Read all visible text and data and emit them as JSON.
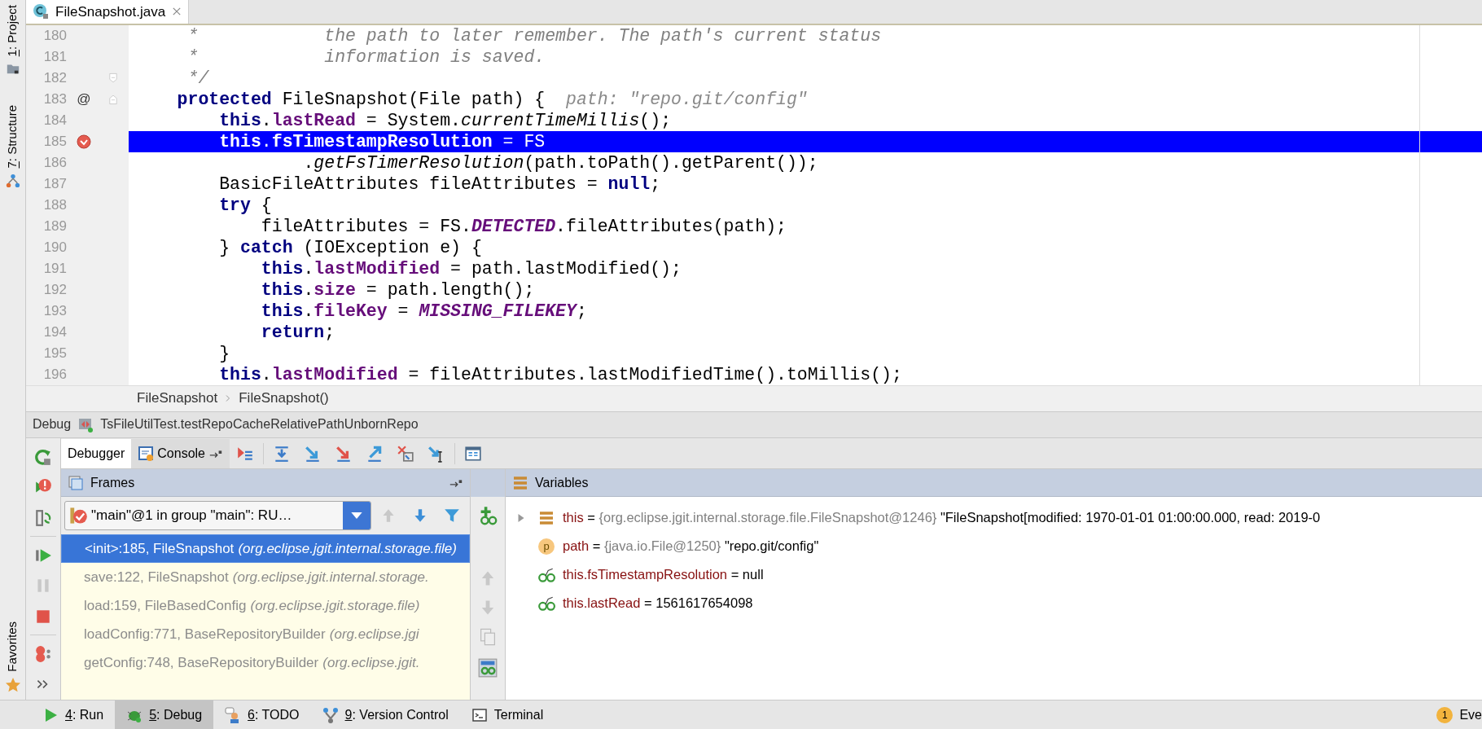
{
  "left_strip": {
    "top": [
      {
        "mnemonic": "1",
        "label": ": Project"
      },
      {
        "mnemonic": "7",
        "label": ": Structure"
      }
    ],
    "bottom": [
      {
        "label": "Favorites"
      }
    ]
  },
  "editor_tabs": [
    {
      "label": "FileSnapshot.java",
      "selected": true
    }
  ],
  "editor": {
    "lines": [
      {
        "number": "180",
        "tokens": [
          {
            "kind": "comment",
            "text": "     *            the path to later remember. The path's current status"
          }
        ]
      },
      {
        "number": "181",
        "tokens": [
          {
            "kind": "comment",
            "text": "     *            information is saved."
          }
        ]
      },
      {
        "number": "182",
        "fold_close": true,
        "tokens": [
          {
            "kind": "comment",
            "text": "     */"
          }
        ]
      },
      {
        "number": "183",
        "marker": "@",
        "fold_open": true,
        "tokens": [
          {
            "kind": "keyword",
            "text": "    protected"
          },
          {
            "kind": "plain",
            "text": " FileSnapshot(File path) {  "
          },
          {
            "kind": "hint",
            "text": "path: \"repo.git/config\""
          }
        ]
      },
      {
        "number": "184",
        "tokens": [
          {
            "kind": "keyword",
            "text": "        this"
          },
          {
            "kind": "plain",
            "text": "."
          },
          {
            "kind": "field",
            "text": "lastRead"
          },
          {
            "kind": "plain",
            "text": " = System."
          },
          {
            "kind": "static",
            "text": "currentTimeMillis"
          },
          {
            "kind": "plain",
            "text": "();"
          }
        ]
      },
      {
        "number": "185",
        "breakpoint": true,
        "current": true,
        "tokens": [
          {
            "kind": "keyword",
            "text": "        this"
          },
          {
            "kind": "plain",
            "text": "."
          },
          {
            "kind": "field",
            "text": "fsTimestampResolution"
          },
          {
            "kind": "plain",
            "text": " = FS"
          }
        ]
      },
      {
        "number": "186",
        "tokens": [
          {
            "kind": "plain",
            "text": "                ."
          },
          {
            "kind": "static",
            "text": "getFsTimerResolution"
          },
          {
            "kind": "plain",
            "text": "(path.toPath().getParent());"
          }
        ]
      },
      {
        "number": "187",
        "tokens": [
          {
            "kind": "plain",
            "text": "        BasicFileAttributes fileAttributes = "
          },
          {
            "kind": "keyword",
            "text": "null"
          },
          {
            "kind": "plain",
            "text": ";"
          }
        ]
      },
      {
        "number": "188",
        "tokens": [
          {
            "kind": "keyword",
            "text": "        try"
          },
          {
            "kind": "plain",
            "text": " {"
          }
        ]
      },
      {
        "number": "189",
        "tokens": [
          {
            "kind": "plain",
            "text": "            fileAttributes = FS."
          },
          {
            "kind": "constant",
            "text": "DETECTED"
          },
          {
            "kind": "plain",
            "text": ".fileAttributes(path);"
          }
        ]
      },
      {
        "number": "190",
        "tokens": [
          {
            "kind": "plain",
            "text": "        } "
          },
          {
            "kind": "keyword",
            "text": "catch"
          },
          {
            "kind": "plain",
            "text": " (IOException e) {"
          }
        ]
      },
      {
        "number": "191",
        "tokens": [
          {
            "kind": "keyword",
            "text": "            this"
          },
          {
            "kind": "plain",
            "text": "."
          },
          {
            "kind": "field",
            "text": "lastModified"
          },
          {
            "kind": "plain",
            "text": " = path.lastModified();"
          }
        ]
      },
      {
        "number": "192",
        "tokens": [
          {
            "kind": "keyword",
            "text": "            this"
          },
          {
            "kind": "plain",
            "text": "."
          },
          {
            "kind": "field",
            "text": "size"
          },
          {
            "kind": "plain",
            "text": " = path.length();"
          }
        ]
      },
      {
        "number": "193",
        "tokens": [
          {
            "kind": "keyword",
            "text": "            this"
          },
          {
            "kind": "plain",
            "text": "."
          },
          {
            "kind": "field",
            "text": "fileKey"
          },
          {
            "kind": "plain",
            "text": " = "
          },
          {
            "kind": "constant",
            "text": "MISSING_FILEKEY"
          },
          {
            "kind": "plain",
            "text": ";"
          }
        ]
      },
      {
        "number": "194",
        "tokens": [
          {
            "kind": "keyword",
            "text": "            return"
          },
          {
            "kind": "plain",
            "text": ";"
          }
        ]
      },
      {
        "number": "195",
        "tokens": [
          {
            "kind": "plain",
            "text": "        }"
          }
        ]
      },
      {
        "number": "196",
        "tokens": [
          {
            "kind": "keyword",
            "text": "        this"
          },
          {
            "kind": "plain",
            "text": "."
          },
          {
            "kind": "field",
            "text": "lastModified"
          },
          {
            "kind": "plain",
            "text": " = fileAttributes.lastModifiedTime().toMillis();"
          }
        ]
      }
    ]
  },
  "breadcrumbs": [
    "FileSnapshot",
    "FileSnapshot()"
  ],
  "debug": {
    "title": "Debug",
    "session": "TsFileUtilTest.testRepoCacheRelativePathUnbornRepo",
    "tabs": [
      {
        "label": "Debugger",
        "selected": true
      },
      {
        "label": "Console",
        "selected": false
      }
    ],
    "frames": {
      "title": "Frames",
      "thread": "\"main\"@1 in group \"main\": RU…",
      "items": [
        {
          "method": "<init>:185, FileSnapshot",
          "package": "(org.eclipse.jgit.internal.storage.file)",
          "selected": true
        },
        {
          "method": "save:122, FileSnapshot",
          "package": "(org.eclipse.jgit.internal.storage.",
          "selected": false
        },
        {
          "method": "load:159, FileBasedConfig",
          "package": "(org.eclipse.jgit.storage.file)",
          "selected": false
        },
        {
          "method": "loadConfig:771, BaseRepositoryBuilder",
          "package": "(org.eclipse.jgi",
          "selected": false
        },
        {
          "method": "getConfig:748, BaseRepositoryBuilder",
          "package": "(org.eclipse.jgit.",
          "selected": false
        }
      ]
    },
    "variables": {
      "title": "Variables",
      "items": [
        {
          "kind": "object",
          "expandable": true,
          "name": "this",
          "equals": "=",
          "type": "{org.eclipse.jgit.internal.storage.file.FileSnapshot@1246}",
          "value": "\"FileSnapshot[modified: 1970-01-01 01:00:00.000, read: 2019-0"
        },
        {
          "kind": "parameter",
          "badge": "p",
          "expandable": false,
          "name": "path",
          "equals": "=",
          "type": "{java.io.File@1250}",
          "value": "\"repo.git/config\""
        },
        {
          "kind": "watch",
          "expandable": false,
          "name": "this.fsTimestampResolution",
          "equals": "=",
          "value": "null"
        },
        {
          "kind": "watch",
          "expandable": false,
          "name": "this.lastRead",
          "equals": "=",
          "value": "1561617654098"
        }
      ]
    }
  },
  "status_bar": {
    "tools": [
      {
        "mnemonic": "4",
        "label": ": Run",
        "selected": false
      },
      {
        "mnemonic": "5",
        "label": ": Debug",
        "selected": true
      },
      {
        "mnemonic": "6",
        "label": ": TODO",
        "selected": false
      },
      {
        "mnemonic": "9",
        "label": ": Version Control",
        "selected": false
      },
      {
        "label": "Terminal",
        "selected": false
      }
    ],
    "event_log": {
      "count": "1",
      "label": "Eve"
    }
  }
}
